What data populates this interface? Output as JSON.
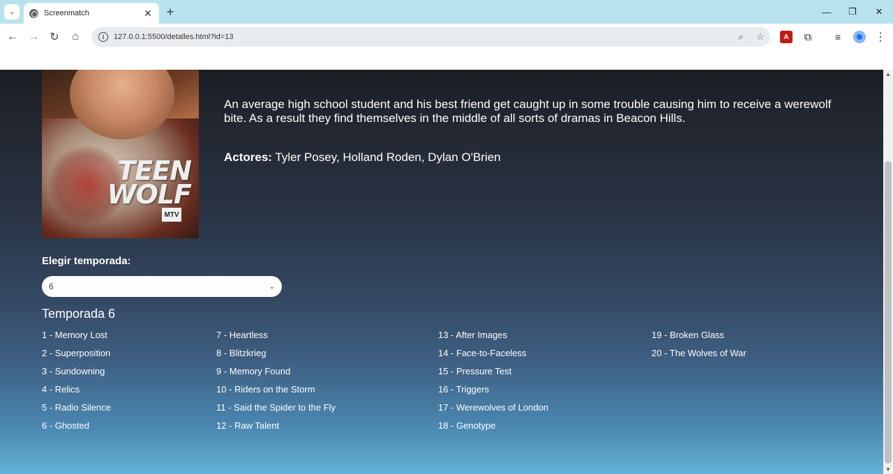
{
  "browser": {
    "tab_title": "Screenmatch",
    "tab_close": "✕",
    "new_tab": "+",
    "url": "127.0.0.1:5500/detalles.html?id=13",
    "icons": [
      "chevron-down-icon",
      "back-icon",
      "forward-icon",
      "reload-icon",
      "home-icon",
      "site-info-icon",
      "zoom-icon",
      "star-icon",
      "pdf-icon",
      "extensions-icon",
      "media-control-icon",
      "profile-icon",
      "menu-icon",
      "minimize-icon",
      "restore-icon",
      "close-icon"
    ]
  },
  "page": {
    "poster": {
      "logo_text": "TEEN WOLF",
      "network": "MTV"
    },
    "synopsis": "An average high school student and his best friend get caught up in some trouble causing him to receive a werewolf bite. As a result they find themselves in the middle of all sorts of dramas in Beacon Hills.",
    "actors_label": "Actores:",
    "actors": "Tyler Posey, Holland Roden, Dylan O'Brien",
    "season_label": "Elegir temporada:",
    "season_selected": "6",
    "season_title": "Temporada 6",
    "episodes": [
      "1 - Memory Lost",
      "2 - Superposition",
      "3 - Sundowning",
      "4 - Relics",
      "5 - Radio Silence",
      "6 - Ghosted",
      "7 - Heartless",
      "8 - Blitzkrieg",
      "9 - Memory Found",
      "10 - Riders on the Storm",
      "11 - Said the Spider to the Fly",
      "12 - Raw Talent",
      "13 - After Images",
      "14 - Face-to-Faceless",
      "15 - Pressure Test",
      "16 - Triggers",
      "17 - Werewolves of London",
      "18 - Genotype",
      "19 - Broken Glass",
      "20 - The Wolves of War"
    ]
  }
}
